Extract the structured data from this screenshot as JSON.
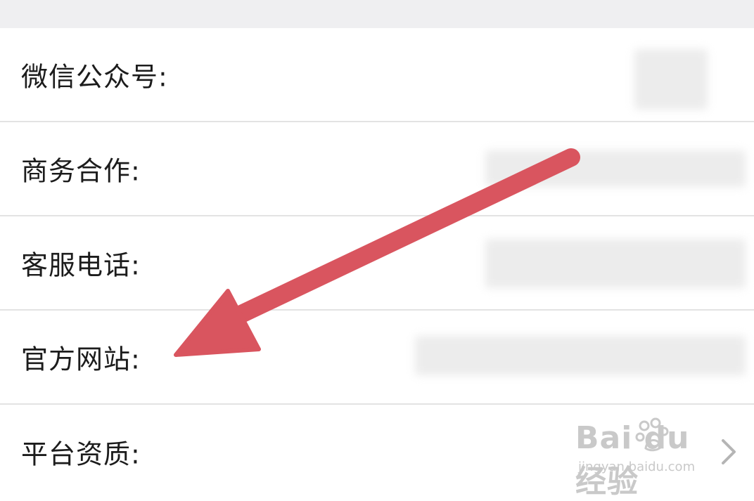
{
  "rows": [
    {
      "label": "微信公众号:"
    },
    {
      "label": "商务合作:"
    },
    {
      "label": "客服电话:"
    },
    {
      "label": "官方网站:"
    },
    {
      "label": "平台资质:"
    }
  ],
  "watermark": {
    "brand": "Bai du 经验",
    "site": "jingyan.baidu.com"
  },
  "icons": {
    "chevron": "chevron-right-icon",
    "annotation": "arrow-icon"
  },
  "colors": {
    "arrow": "#d9555f",
    "separator": "#e3e3e3",
    "top_strip": "#efeff1"
  }
}
